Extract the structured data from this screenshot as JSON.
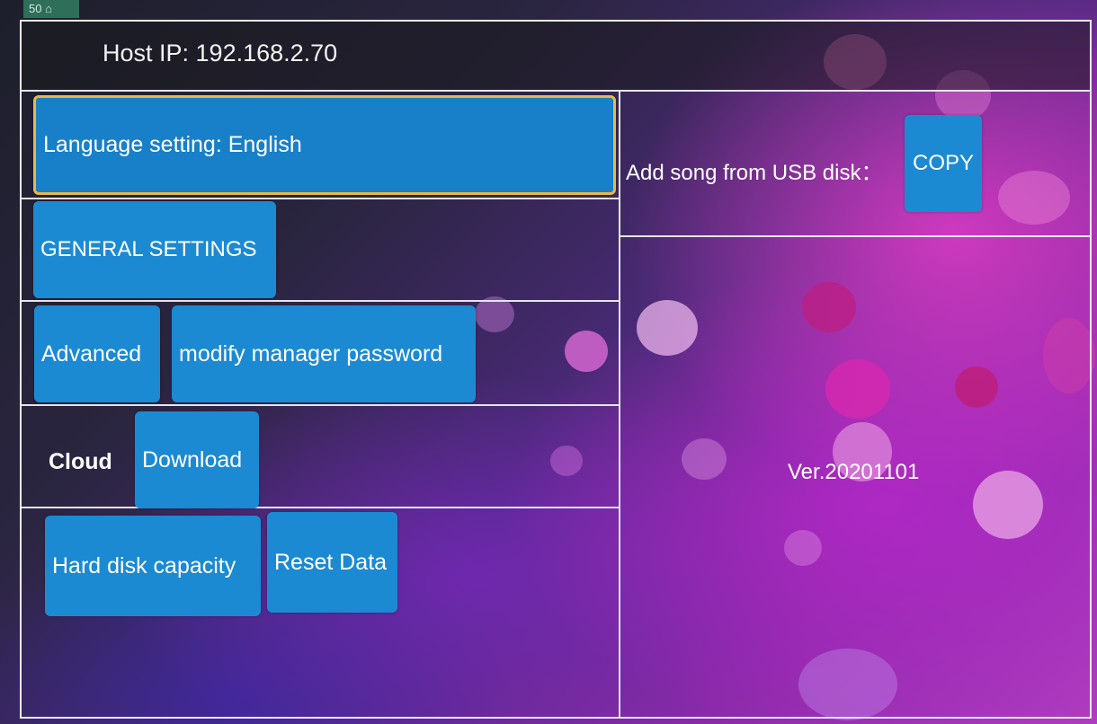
{
  "status_chip": "50 ⌂",
  "header": {
    "host_ip": "Host IP: 192.168.2.70"
  },
  "left_panel": {
    "language_button": "Language setting: English",
    "general_settings_button": "GENERAL SETTINGS",
    "advanced_button": "Advanced",
    "modify_password_button": "modify manager password",
    "cloud_label": "Cloud",
    "download_button": "Download",
    "hard_disk_button": "Hard disk capacity",
    "reset_data_button": "Reset Data"
  },
  "right_panel": {
    "usb_label": "Add song from USB disk：",
    "copy_button": "COPY",
    "version": "Ver.20201101"
  },
  "colors": {
    "button_blue": "#1b8ad2",
    "selected_border": "#e6b94a",
    "divider": "#e5e5ec"
  }
}
